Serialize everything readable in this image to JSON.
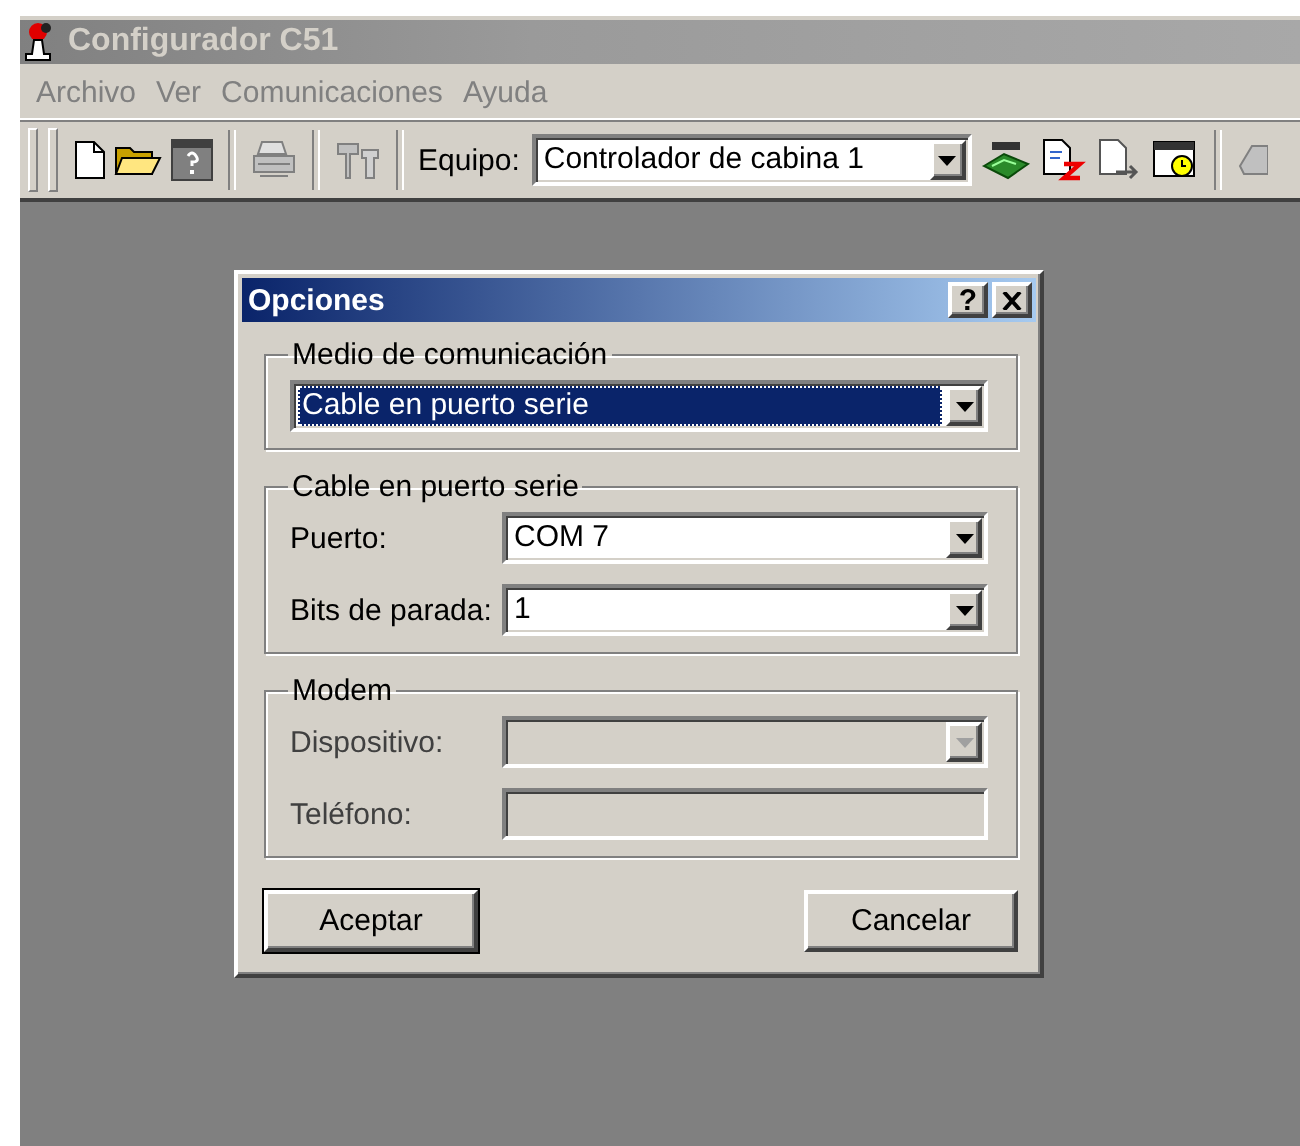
{
  "window": {
    "title": "Configurador C51"
  },
  "menu": [
    {
      "label": "Archivo"
    },
    {
      "label": "Ver"
    },
    {
      "label": "Comunicaciones"
    },
    {
      "label": "Ayuda"
    }
  ],
  "toolbar": {
    "equipo_label": "Equipo:",
    "equipo_value": "Controlador de cabina 1"
  },
  "dialog": {
    "title": "Opciones",
    "help": "?",
    "groups": [
      {
        "title": "Medio de comunicación",
        "fields": [
          {
            "kind": "combo",
            "value": "Cable en puerto serie",
            "focused": true,
            "disabled": false
          }
        ]
      },
      {
        "title": "Cable en puerto serie",
        "fields": [
          {
            "kind": "combo",
            "label": "Puerto:",
            "value": "COM 7",
            "focused": false,
            "disabled": false
          },
          {
            "kind": "combo",
            "label": "Bits de parada:",
            "value": "1",
            "focused": false,
            "disabled": false
          }
        ]
      },
      {
        "title": "Modem",
        "fields": [
          {
            "kind": "combo",
            "label": "Dispositivo:",
            "disabled": true
          },
          {
            "kind": "text",
            "label": "Teléfono:",
            "disabled": true
          }
        ]
      }
    ],
    "buttons": [
      {
        "label": "Aceptar",
        "default": true
      },
      {
        "label": "Cancelar",
        "default": false
      }
    ]
  }
}
